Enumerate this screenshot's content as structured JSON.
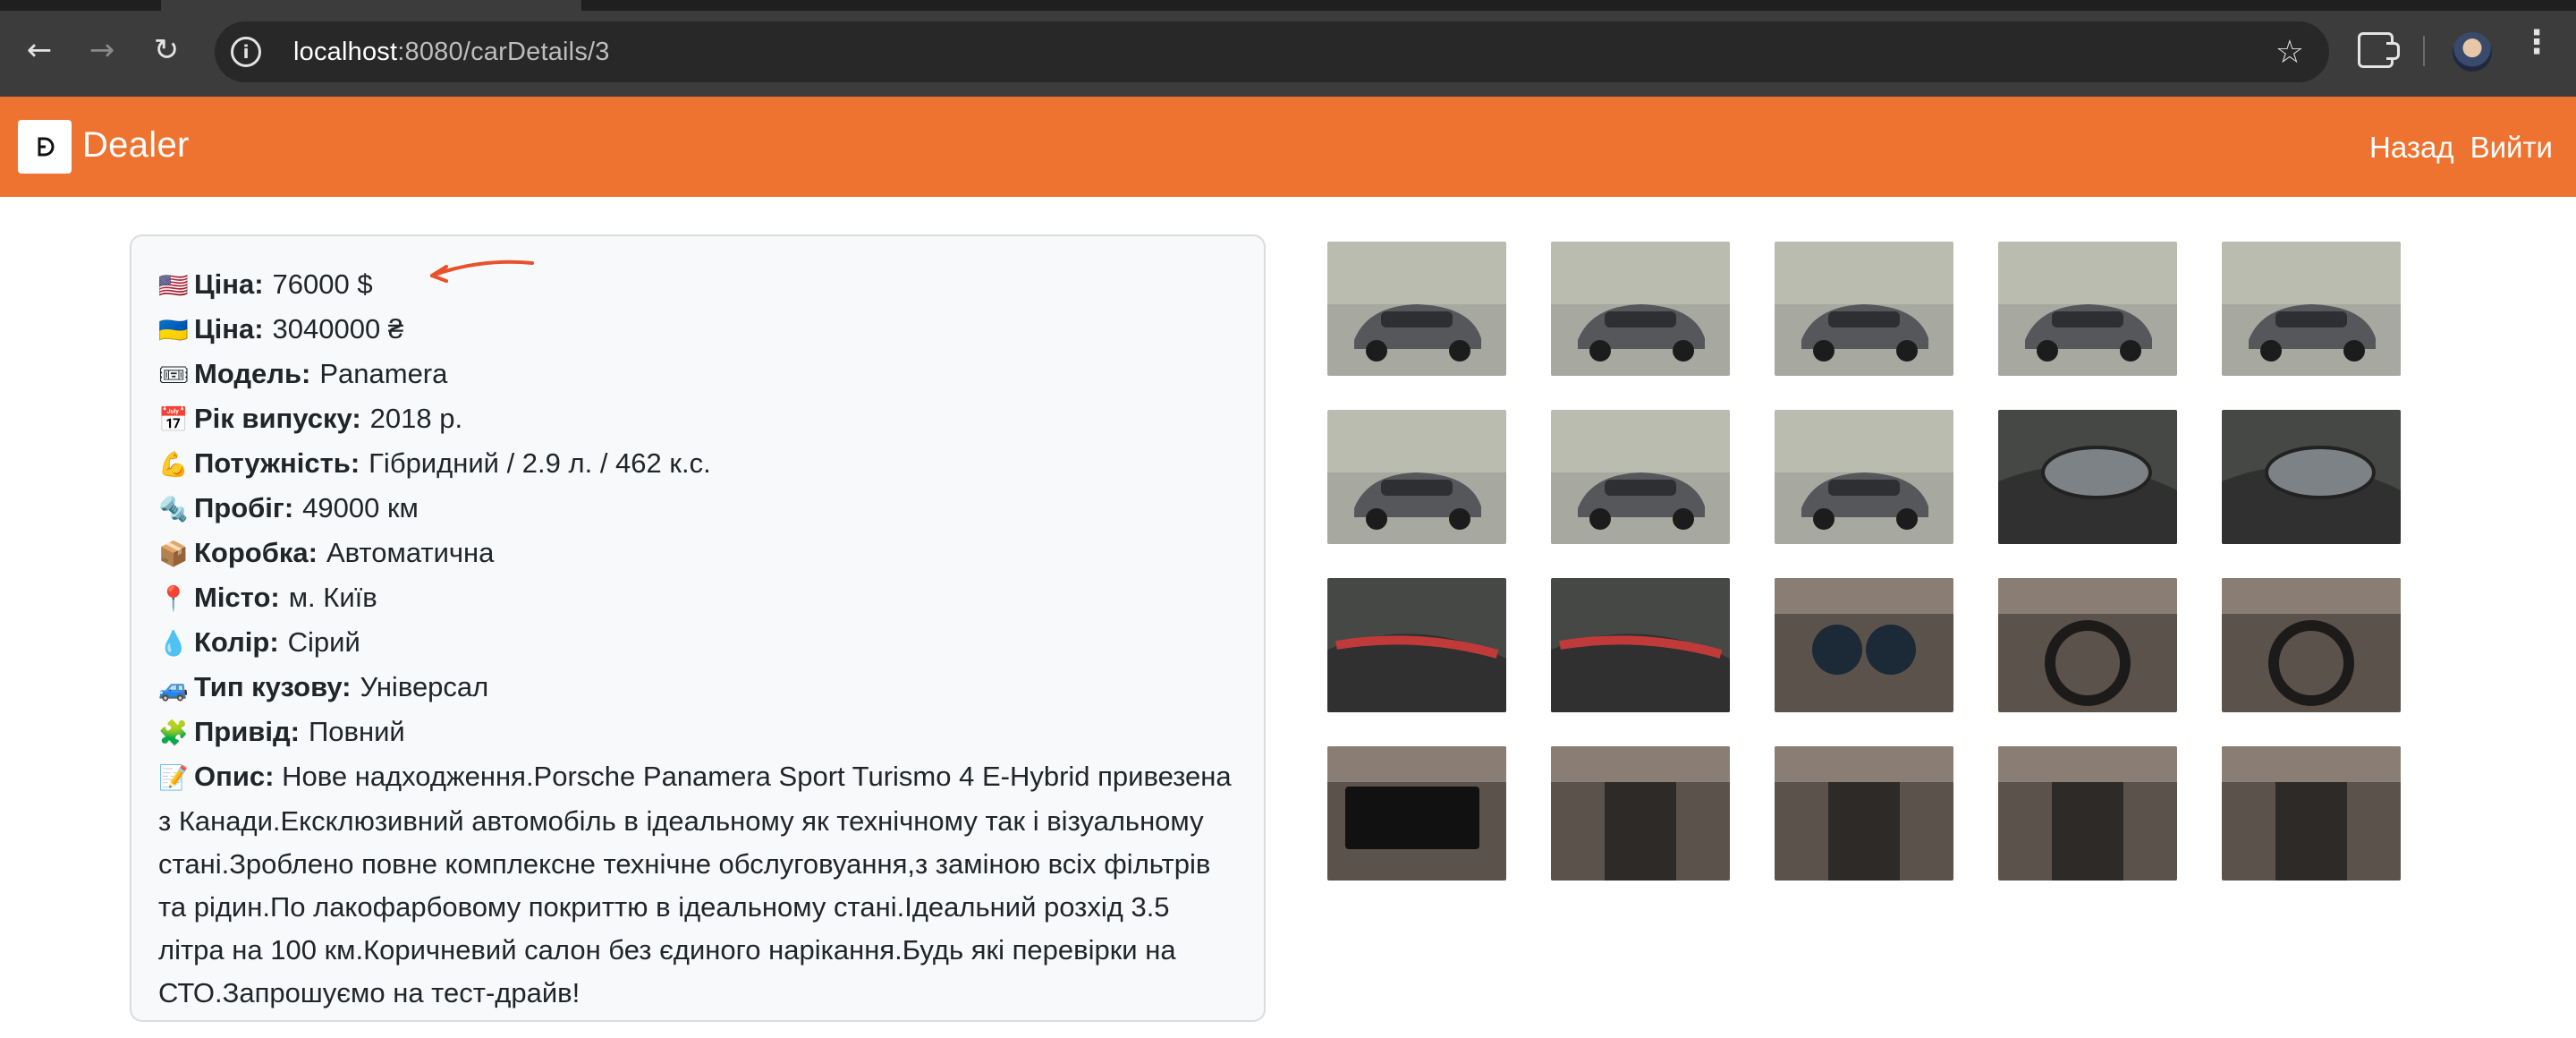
{
  "browser": {
    "url_host": "localhost",
    "url_path": ":8080/carDetails/3",
    "back_icon": "arrow-left-icon",
    "forward_icon": "arrow-right-icon",
    "reload_icon": "reload-icon",
    "bookmark_icon": "star-icon",
    "extensions_icon": "puzzle-icon",
    "menu_icon": "kebab-icon"
  },
  "header": {
    "logo_letter": "D",
    "brand": "Dealer",
    "links": [
      "Назад",
      "Вийти"
    ],
    "color": "#ef7330"
  },
  "details": {
    "rows": [
      {
        "emoji": "🇺🇸",
        "label": "Ціна:",
        "value": "76000 $"
      },
      {
        "emoji": "🇺🇦",
        "label": "Ціна:",
        "value": "3040000 ₴"
      },
      {
        "emoji": "🎟",
        "label": "Модель:",
        "value": "Panamera"
      },
      {
        "emoji": "📅",
        "label": "Рік випуску:",
        "value": "2018 р."
      },
      {
        "emoji": "💪",
        "label": "Потужність:",
        "value": "Гібридний / 2.9 л. / 462 к.с."
      },
      {
        "emoji": "🔩",
        "label": "Пробіг:",
        "value": "49000 км"
      },
      {
        "emoji": "📦",
        "label": "Коробка:",
        "value": "Автоматична"
      },
      {
        "emoji": "📍",
        "label": "Місто:",
        "value": "м. Київ"
      },
      {
        "emoji": "💧",
        "label": "Колір:",
        "value": "Сірий"
      },
      {
        "emoji": "🚙",
        "label": "Тип кузову:",
        "value": "Універсал"
      },
      {
        "emoji": "🧩",
        "label": "Привід:",
        "value": "Повний"
      }
    ],
    "description": {
      "emoji": "📝",
      "label": "Опис:",
      "text": "Нове надходження.Porsche Panamera Sport Turismo 4 E-Hybrid привезена з Канади.Ексклюзивний автомобіль в ідеальному як технічному так і візуальному стані.Зроблено повне комплексне технічне обслуговуання,з заміною всіх фільтрів та рідин.По лакофарбовому покриттю в ідеальному стані.Ідеальний розхід 3.5 літра на 100 км.Коричневий салон без єдиного нарікання.Будь які перевірки на СТО.Запрошуємо на тест-драйв!"
    },
    "annotation_arrow_color": "#e8512a"
  },
  "gallery": {
    "photos": [
      {
        "kind": "exterior",
        "view": "front-left"
      },
      {
        "kind": "exterior",
        "view": "front"
      },
      {
        "kind": "exterior",
        "view": "side-front"
      },
      {
        "kind": "exterior",
        "view": "side"
      },
      {
        "kind": "exterior",
        "view": "rear-right"
      },
      {
        "kind": "exterior",
        "view": "rear"
      },
      {
        "kind": "exterior",
        "view": "rear-left"
      },
      {
        "kind": "exterior",
        "view": "side-far"
      },
      {
        "kind": "detail",
        "view": "headlight"
      },
      {
        "kind": "detail",
        "view": "headlight"
      },
      {
        "kind": "detail",
        "view": "taillight"
      },
      {
        "kind": "detail",
        "view": "taillight"
      },
      {
        "kind": "interior",
        "view": "gauges"
      },
      {
        "kind": "interior",
        "view": "steering-wheel"
      },
      {
        "kind": "interior",
        "view": "steering-wheel"
      },
      {
        "kind": "interior",
        "view": "infotainment"
      },
      {
        "kind": "interior",
        "view": "console"
      },
      {
        "kind": "interior",
        "view": "rear-seats"
      },
      {
        "kind": "interior",
        "view": "dashboard"
      },
      {
        "kind": "interior",
        "view": "cabin"
      }
    ]
  }
}
